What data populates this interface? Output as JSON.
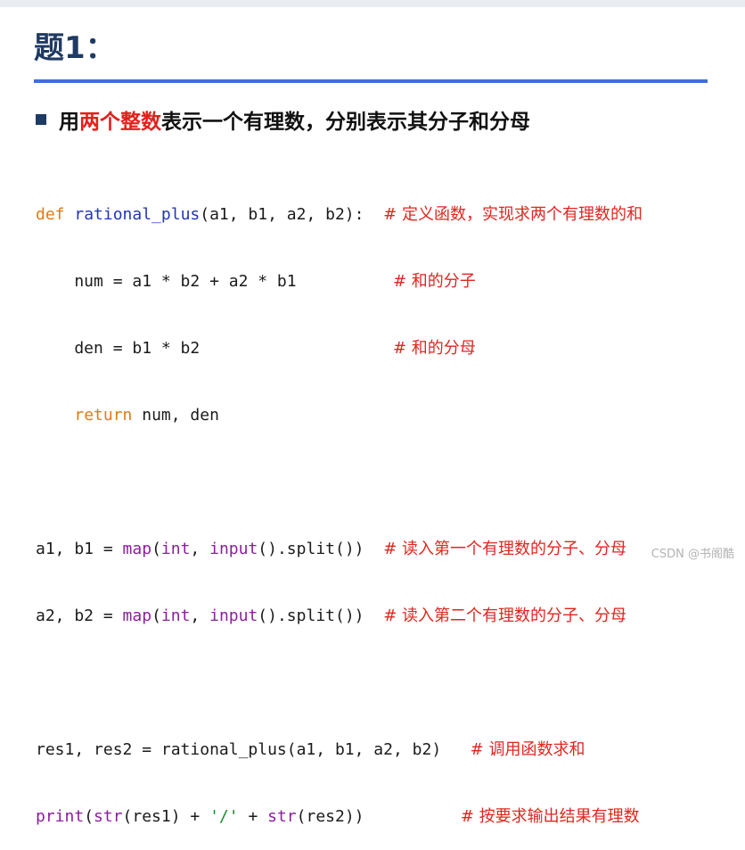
{
  "slide": {
    "title": "题1：",
    "bullet": {
      "prefix": "用",
      "highlight": "两个整数",
      "suffix": "表示一个有理数，分别表示其分子和分母"
    },
    "accent_colors": {
      "title": "#1f3a63",
      "rule": "#3f6fd8",
      "highlight": "#e3201b"
    }
  },
  "code": {
    "l1": {
      "kw": "def",
      "sp": " ",
      "fn": "rational_plus",
      "args": "(a1, b1, a2, b2):  ",
      "comment": "# 定义函数，实现求两个有理数的和"
    },
    "l2": {
      "text": "    num = a1 * b2 + a2 * b1          ",
      "comment": "# 和的分子"
    },
    "l3": {
      "text": "    den = b1 * b2                    ",
      "comment": "# 和的分母"
    },
    "l4": {
      "indent": "    ",
      "kw": "return",
      "text": " num, den"
    },
    "l6": {
      "lhs": "a1, b1 = ",
      "map": "map",
      "p1": "(",
      "int": "int",
      "p2": ", ",
      "input": "input",
      "rest": "().split())  ",
      "comment": "# 读入第一个有理数的分子、分母"
    },
    "l7": {
      "lhs": "a2, b2 = ",
      "map": "map",
      "p1": "(",
      "int": "int",
      "p2": ", ",
      "input": "input",
      "rest": "().split())  ",
      "comment": "# 读入第二个有理数的分子、分母"
    },
    "l9": {
      "text": "res1, res2 = rational_plus(a1, b1, a2, b2)   ",
      "comment": "# 调用函数求和"
    },
    "l10": {
      "print": "print",
      "p1": "(",
      "str1": "str",
      "mid": "(res1) + ",
      "lit": "'/'",
      "plus": " + ",
      "str2": "str",
      "end": "(res2))          ",
      "comment": "# 按要求输出结果有理数"
    }
  },
  "watermark": "CSDN @书阁酷"
}
